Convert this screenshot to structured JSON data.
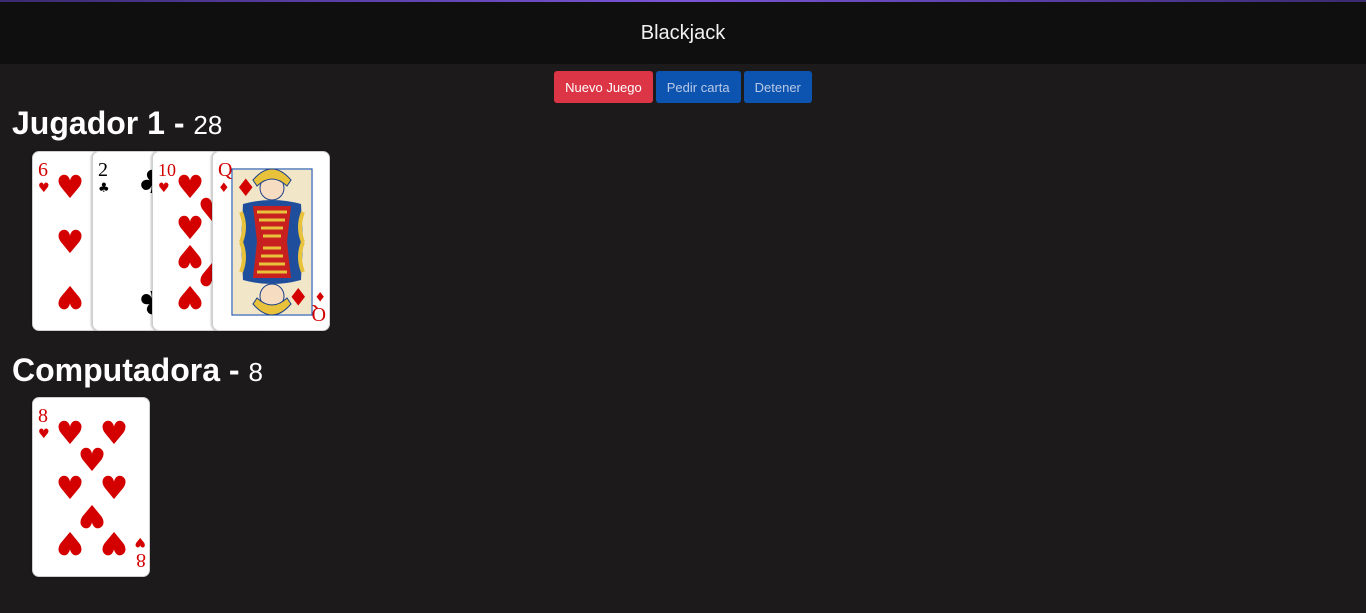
{
  "header": {
    "title": "Blackjack"
  },
  "controls": {
    "new_game": "Nuevo Juego",
    "hit": "Pedir carta",
    "stand": "Detener"
  },
  "player": {
    "name": "Jugador 1",
    "separator": " - ",
    "score": "28",
    "cards": [
      {
        "rank": "6",
        "suit": "hearts"
      },
      {
        "rank": "2",
        "suit": "clubs"
      },
      {
        "rank": "10",
        "suit": "hearts"
      },
      {
        "rank": "Q",
        "suit": "diamonds"
      }
    ]
  },
  "computer": {
    "name": "Computadora",
    "separator": " - ",
    "score": "8",
    "cards": [
      {
        "rank": "8",
        "suit": "hearts"
      }
    ]
  },
  "colors": {
    "background": "#1c1a1b",
    "header_bg": "#0f0f0f",
    "danger": "#dc3545",
    "primary": "#0d54b0",
    "card_red": "#d40000",
    "card_black": "#000000"
  }
}
